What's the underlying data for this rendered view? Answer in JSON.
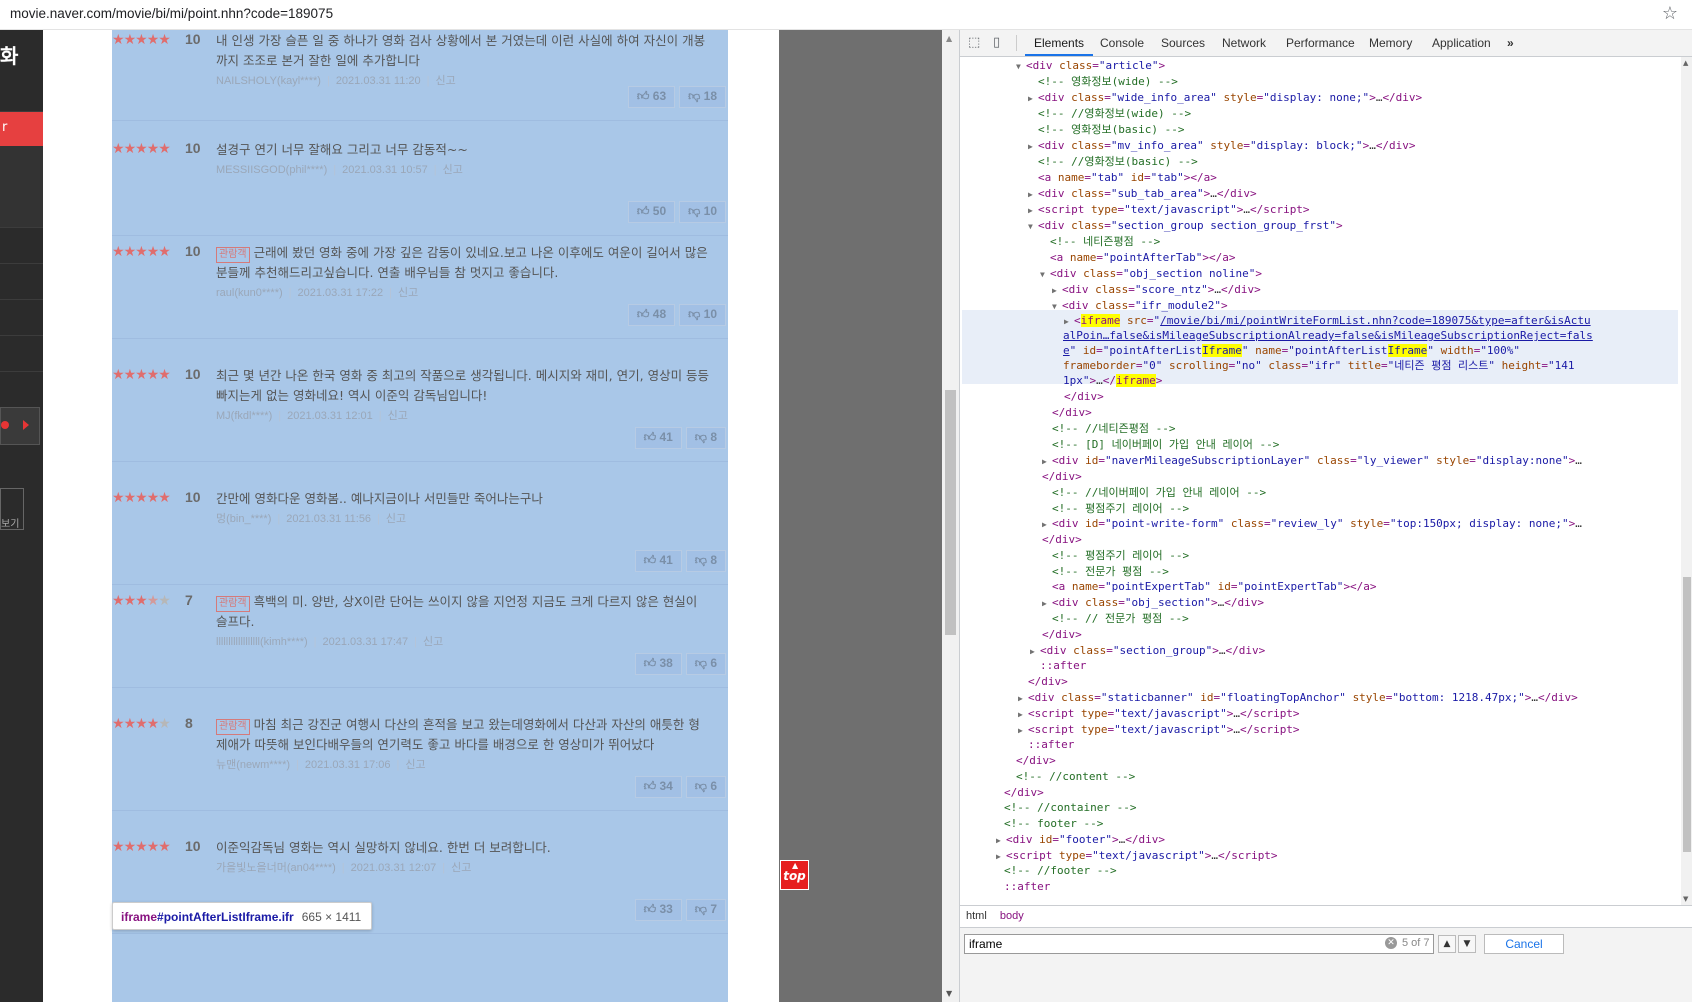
{
  "browser": {
    "url": "movie.naver.com/movie/bi/mi/point.nhn?code=189075"
  },
  "left_panel": {
    "title_char": "화",
    "red_tab_char": "r",
    "view_button": "보기"
  },
  "reviews": [
    {
      "stars": 5,
      "score": "10",
      "badge": "",
      "text": "내 인생 가장 슬픈 일 중 하나가 영화 검사 상황에서 본 거였는데 이런 사실에 하여 자신이 개봉까지 조조로 본거 잘한 일에 추가합니다",
      "user": "NAILSHOLY(kayl****)",
      "date": "2021.03.31 11:20",
      "report": "신고",
      "up": "63",
      "down": "18"
    },
    {
      "stars": 5,
      "score": "10",
      "badge": "",
      "text": "설경구 연기 너무 잘해요 그리고 너무 감동적~~",
      "user": "MESSIISGOD(phil****)",
      "date": "2021.03.31 10:57",
      "report": "신고",
      "up": "50",
      "down": "10"
    },
    {
      "stars": 5,
      "score": "10",
      "badge": "관람객",
      "text": "근래에 봤던 영화 중에 가장 깊은 감동이 있네요.보고 나온 이후에도 여운이 길어서 많은분들께 추천해드리고싶습니다. 연출 배우님들 참 멋지고 좋습니다.",
      "user": "raul(kun0****)",
      "date": "2021.03.31 17:22",
      "report": "신고",
      "up": "48",
      "down": "10"
    },
    {
      "stars": 5,
      "score": "10",
      "badge": "",
      "text": "최근 몇 년간 나온 한국 영화 중 최고의 작품으로 생각됩니다. 메시지와 재미, 연기, 영상미 등등 빠지는게 없는 영화네요! 역시 이준익 감독님입니다!",
      "user": "MJ(fkdl****)",
      "date": "2021.03.31 12:01",
      "report": "신고",
      "up": "41",
      "down": "8"
    },
    {
      "stars": 5,
      "score": "10",
      "badge": "",
      "text": "간만에 영화다운 영화봄.. 예나지금이나 서민들만 죽어나는구나",
      "user": "멍(bin_****)",
      "date": "2021.03.31 11:56",
      "report": "신고",
      "up": "41",
      "down": "8"
    },
    {
      "stars": 3.5,
      "score": "7",
      "badge": "관람객",
      "text": "흑백의 미. 양반, 상X이란 단어는 쓰이지 않을 지언정 지금도 크게 다르지 않은 현실이 슬프다.",
      "user": "llllllllllllllllll(kimh****)",
      "date": "2021.03.31 17:47",
      "report": "신고",
      "up": "38",
      "down": "6"
    },
    {
      "stars": 4,
      "score": "8",
      "badge": "관람객",
      "text": "마침 최근 강진군 여행시 다산의 흔적을 보고 왔는데영화에서 다산과 자산의 애틋한 형제애가 따뜻해 보인다배우들의 연기력도 좋고 바다를 배경으로 한 영상미가 뛰어났다",
      "user": "뉴맨(newm****)",
      "date": "2021.03.31 17:06",
      "report": "신고",
      "up": "34",
      "down": "6"
    },
    {
      "stars": 5,
      "score": "10",
      "badge": "",
      "text": "이준익감독님 영화는 역시 실망하지 않네요. 한번 더 보려합니다.",
      "user": "가을빛노을너머(an04****)",
      "date": "2021.03.31 12:07",
      "report": "신고",
      "up": "33",
      "down": "7"
    }
  ],
  "top_button": "top",
  "tooltip": {
    "selector_tag": "iframe",
    "selector_rest": "#pointAfterListIframe.ifr",
    "dims": "665 × 1411"
  },
  "devtools": {
    "tabs": [
      "Elements",
      "Console",
      "Sources",
      "Network",
      "Performance",
      "Memory",
      "Application"
    ],
    "more": "»",
    "breadcrumbs": [
      "html",
      "body"
    ],
    "search_value": "iframe",
    "search_count": "5 of 7",
    "cancel_label": "Cancel"
  },
  "colors": {
    "selection_overlay": "#a9c7e8",
    "naver_red": "#e61e1e",
    "devtools_accent": "#1a73e8"
  }
}
